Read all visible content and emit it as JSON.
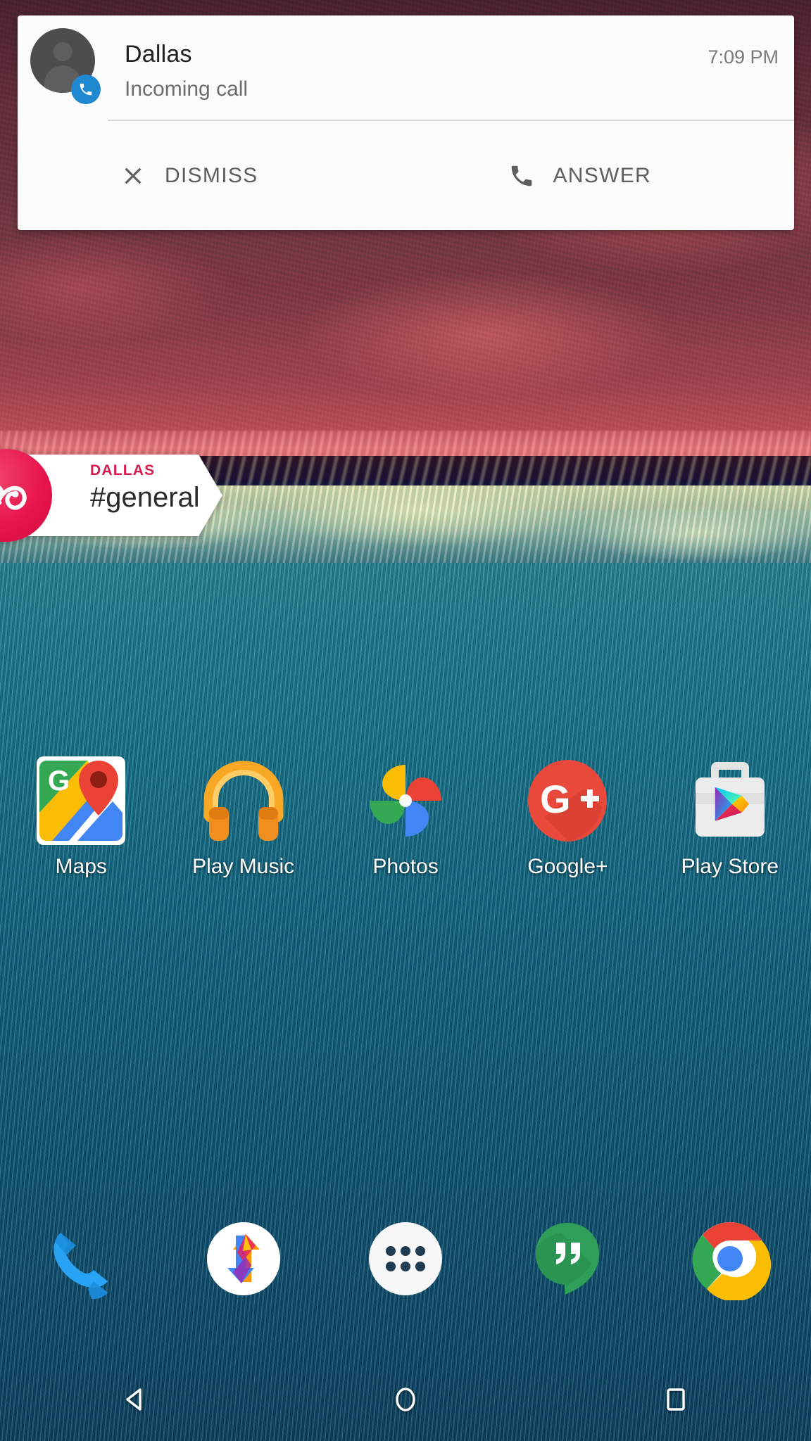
{
  "notification": {
    "title": "Dallas",
    "subtitle": "Incoming call",
    "time": "7:09 PM",
    "avatar_icon": "person-avatar-icon",
    "badge_icon": "phone-icon",
    "actions": [
      {
        "label": "DISMISS",
        "icon": "close-x-icon"
      },
      {
        "label": "ANSWER",
        "icon": "phone-handset-icon"
      }
    ],
    "colors": {
      "card_bg": "#fbfbfb",
      "title": "#212121",
      "subtitle": "#6d6d6d",
      "time": "#7a7a7a",
      "action_text": "#5e5e5e",
      "badge_blue": "#1e88d0",
      "avatar_gray": "#4d4d4d"
    }
  },
  "channel_badge": {
    "workspace": "DALLAS",
    "channel": "#general",
    "logo_icon": "infinity-loop-icon",
    "colors": {
      "circle": "#e8144c",
      "kicker": "#d81b4e",
      "channel_text": "#2b2b2b",
      "panel_bg": "#ffffff"
    }
  },
  "home_screen": {
    "apps": [
      {
        "label": "Maps",
        "icon": "google-maps-icon"
      },
      {
        "label": "Play Music",
        "icon": "google-play-music-icon"
      },
      {
        "label": "Photos",
        "icon": "google-photos-icon"
      },
      {
        "label": "Google+",
        "icon": "google-plus-icon"
      },
      {
        "label": "Play Store",
        "icon": "google-play-store-icon"
      }
    ],
    "dock": [
      {
        "name": "Phone",
        "icon": "phone-dialer-icon"
      },
      {
        "name": "Messaging",
        "icon": "arrows-exchange-icon"
      },
      {
        "name": "All Apps",
        "icon": "app-drawer-icon"
      },
      {
        "name": "Hangouts",
        "icon": "hangouts-icon"
      },
      {
        "name": "Chrome",
        "icon": "chrome-icon"
      }
    ],
    "nav_bar": [
      {
        "name": "Back",
        "icon": "back-triangle-icon"
      },
      {
        "name": "Home",
        "icon": "home-circle-icon"
      },
      {
        "name": "Recents",
        "icon": "recents-square-icon"
      }
    ],
    "wallpaper": {
      "name": "satellite-coastline-wallpaper",
      "colors": {
        "terrain_top": "#4a2430",
        "terrain_bottom": "#c1505a",
        "surf": "#f07a80",
        "rock": "#161030",
        "sand": "#eef2b4",
        "ocean_top": "#2a8a96",
        "ocean_bottom": "#0b3e5c"
      }
    }
  }
}
